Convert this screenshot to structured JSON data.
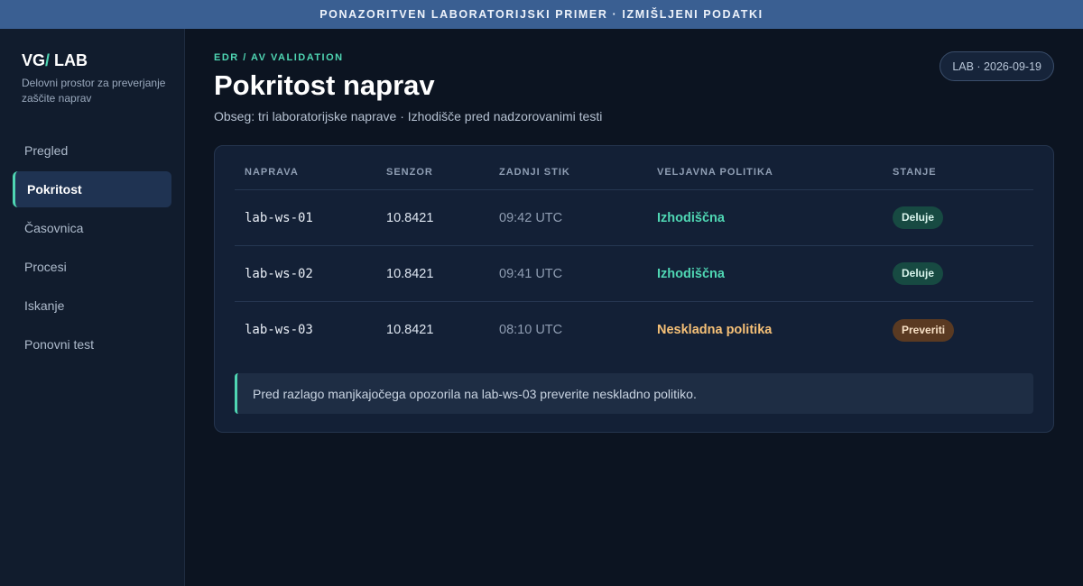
{
  "banner": {
    "text": "PONAZORITVEN LABORATORIJSKI PRIMER · IZMIŠLJENI PODATKI"
  },
  "sidebar": {
    "brand": {
      "prefix": "VG",
      "slash": "/",
      "suffix": " LAB"
    },
    "subtitle": "Delovni prostor za preverjanje zaščite naprav",
    "items": [
      {
        "label": "Pregled",
        "active": false
      },
      {
        "label": "Pokritost",
        "active": true
      },
      {
        "label": "Časovnica",
        "active": false
      },
      {
        "label": "Procesi",
        "active": false
      },
      {
        "label": "Iskanje",
        "active": false
      },
      {
        "label": "Ponovni test",
        "active": false
      }
    ]
  },
  "header": {
    "eyebrow": "EDR / AV VALIDATION",
    "title": "Pokritost naprav",
    "subtitle": "Obseg: tri laboratorijske naprave · Izhodišče pred nadzorovanimi testi",
    "date_pill": "LAB · 2026-09-19"
  },
  "table": {
    "columns": [
      "NAPRAVA",
      "SENZOR",
      "ZADNJI STIK",
      "VELJAVNA POLITIKA",
      "STANJE"
    ],
    "rows": [
      {
        "device": "lab-ws-01",
        "sensor": "10.8421",
        "last_contact": "09:42 UTC",
        "policy": "Izhodiščna",
        "status": "Deluje"
      },
      {
        "device": "lab-ws-02",
        "sensor": "10.8421",
        "last_contact": "09:41 UTC",
        "policy": "Izhodiščna",
        "status": "Deluje"
      },
      {
        "device": "lab-ws-03",
        "sensor": "10.8421",
        "last_contact": "08:10 UTC",
        "policy": "Neskladna politika",
        "status": "Preveriti"
      }
    ]
  },
  "note": {
    "text": "Pred razlago manjkajočega opozorila na lab-ws-03 preverite neskladno politiko."
  },
  "colors": {
    "accent": "#4fd6b3",
    "warning": "#f5c077",
    "banner": "#3a5f92",
    "background": "#0c1421"
  }
}
